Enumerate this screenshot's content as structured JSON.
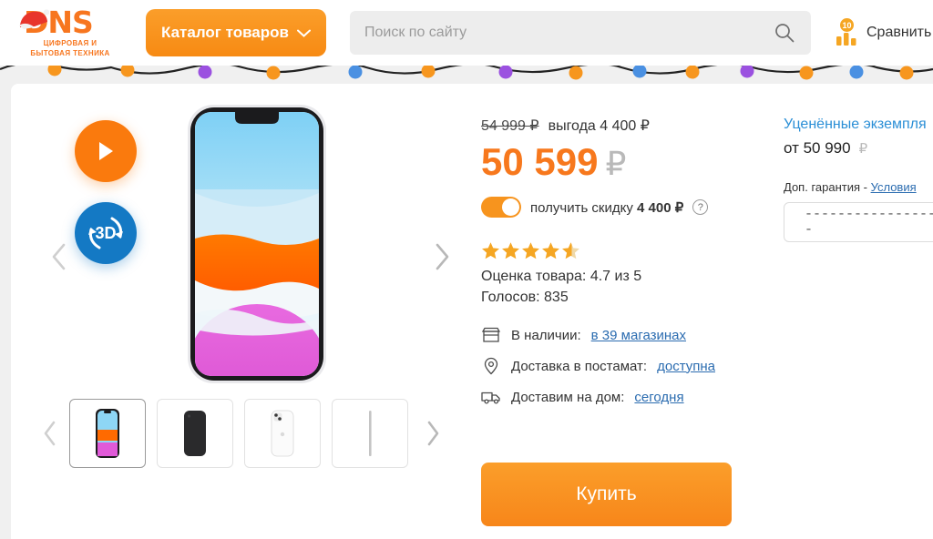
{
  "header": {
    "logo": {
      "name": "DNS",
      "subtitle_line1": "ЦИФРОВАЯ И",
      "subtitle_line2": "БЫТОВАЯ ТЕХНИКА"
    },
    "catalog_button": "Каталог товаров",
    "search": {
      "placeholder": "Поиск по сайту",
      "value": ""
    },
    "compare": {
      "label": "Сравнить",
      "count": "10"
    }
  },
  "gallery": {
    "prev_label": "‹",
    "next_label": "›",
    "play_label": "▶",
    "threed_label": "3D",
    "thumbs": [
      {
        "name": "iphone-front-colorful"
      },
      {
        "name": "iphone-back-black"
      },
      {
        "name": "iphone-back-white"
      },
      {
        "name": "iphone-side-edge"
      }
    ],
    "thumb_prev_label": "‹",
    "thumb_next_label": "›"
  },
  "product": {
    "old_price": "54 999 ₽",
    "benefit": "выгода 4 400 ₽",
    "price": "50 599",
    "currency": "₽",
    "discount_toggle": {
      "on": true,
      "text_prefix": "получить скидку ",
      "amount": "4 400 ₽",
      "help": "?"
    },
    "rating_value": "4.7",
    "rating_line": "Оценка товара: 4.7 из 5",
    "votes_line": "Голосов: 835",
    "stars_filled": 4,
    "stars_half": 1,
    "availability": [
      {
        "icon": "store-icon",
        "label": "В наличии:",
        "link": "в 39 магазинах"
      },
      {
        "icon": "map-pin-icon",
        "label": "Доставка в постамат:",
        "link": "доступна"
      },
      {
        "icon": "truck-icon",
        "label": "Доставим на дом:",
        "link": "сегодня"
      }
    ],
    "buy_button": "Купить"
  },
  "right_panel": {
    "used_title": "Уценённые экземпля",
    "used_price_prefix": "от 50 990",
    "used_currency": "₽",
    "warranty_label": "Доп. гарантия - ",
    "warranty_link": "Условия",
    "warranty_select_value": "------------------"
  },
  "colors": {
    "brand_orange": "#f7861a",
    "price_orange": "#f7781d",
    "link_blue": "#2b6cb0",
    "used_blue": "#2b8fd6",
    "star_gold": "#f5a623",
    "threed_blue": "#1479c4"
  }
}
